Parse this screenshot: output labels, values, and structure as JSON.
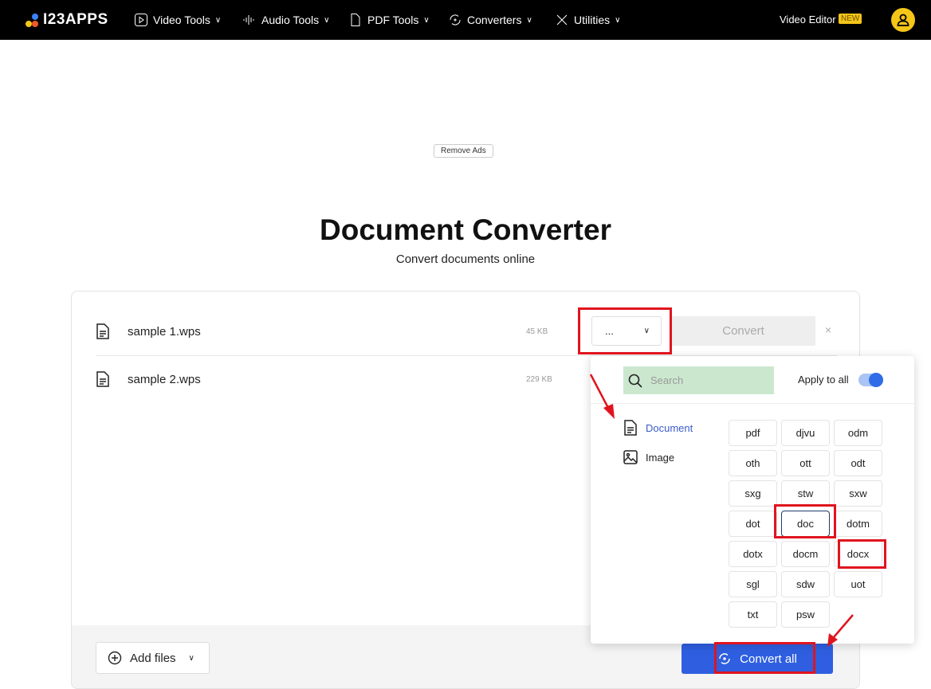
{
  "nav": {
    "logo": "I23APPS",
    "items": [
      {
        "label": "Video Tools",
        "icon": "play-icon"
      },
      {
        "label": "Audio Tools",
        "icon": "audio-wave-icon"
      },
      {
        "label": "PDF Tools",
        "icon": "file-icon"
      },
      {
        "label": "Converters",
        "icon": "convert-icon"
      },
      {
        "label": "Utilities",
        "icon": "tools-icon"
      }
    ],
    "video_editor": "Video Editor",
    "new_badge": "NEW"
  },
  "remove_ads": "Remove Ads",
  "page": {
    "title": "Document Converter",
    "subtitle": "Convert documents online"
  },
  "files": [
    {
      "name": "sample 1.wps",
      "size": "45 KB"
    },
    {
      "name": "sample 2.wps",
      "size": "229 KB"
    }
  ],
  "format_select": {
    "value": "..."
  },
  "convert_label": "Convert",
  "close_label": "×",
  "add_files": "Add files",
  "convert_all": "Convert all",
  "popup": {
    "search_placeholder": "Search",
    "apply_to_all": "Apply to all",
    "apply_to_all_on": true,
    "categories": [
      {
        "label": "Document",
        "active": true
      },
      {
        "label": "Image",
        "active": false
      }
    ],
    "formats": [
      "pdf",
      "djvu",
      "odm",
      "oth",
      "ott",
      "odt",
      "sxg",
      "stw",
      "sxw",
      "dot",
      "doc",
      "dotm",
      "dotx",
      "docm",
      "docx",
      "sgl",
      "sdw",
      "uot",
      "txt",
      "psw"
    ],
    "selected": "doc"
  },
  "colors": {
    "accent": "#2f5fe0",
    "brand_yellow": "#f5c518",
    "annotation_red": "#e0141e",
    "search_highlight": "#cbe8cf"
  }
}
